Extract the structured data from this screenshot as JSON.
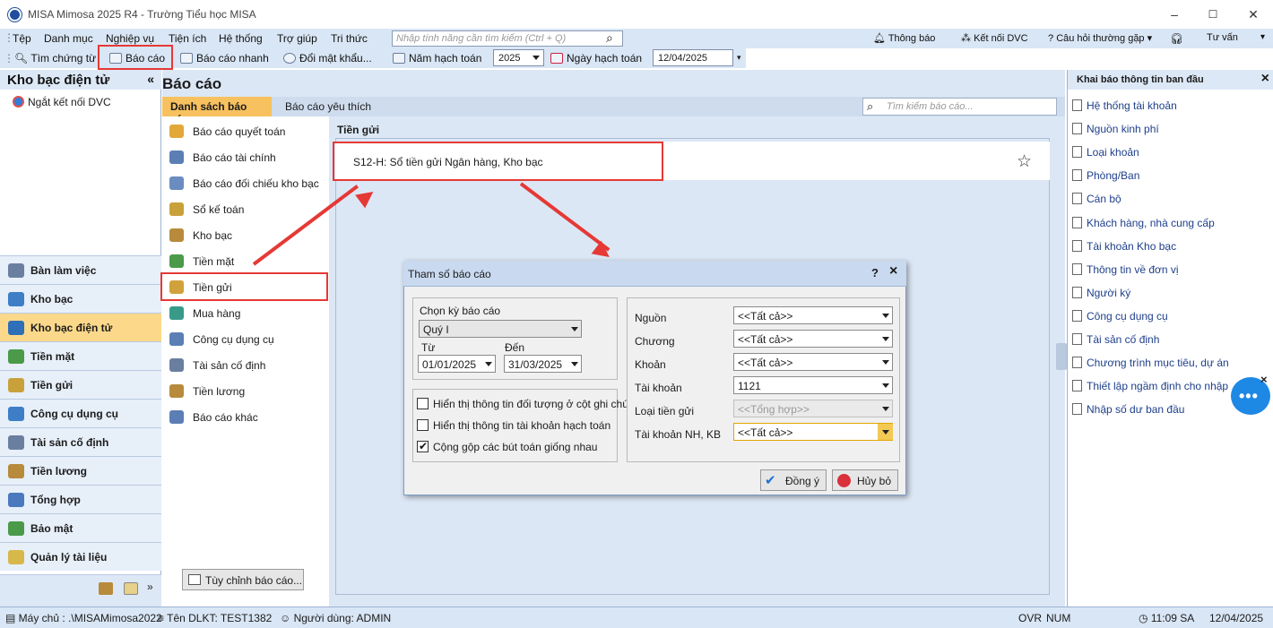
{
  "app": {
    "title": "MISA Mimosa 2025 R4 - Trường Tiểu học MISA"
  },
  "menu": {
    "items": [
      "Tệp",
      "Danh mục",
      "Nghiệp vụ",
      "Tiện ích",
      "Hệ thống",
      "Trợ giúp",
      "Tri thức"
    ],
    "search_placeholder": "Nhập tính năng cần tìm kiếm (Ctrl + Q)",
    "right": {
      "notify": "Thông báo",
      "connect": "Kết nối DVC",
      "faq": "Câu hỏi thường gặp",
      "advisor": "Tư vấn"
    }
  },
  "toolbar": {
    "find": "Tìm chứng từ",
    "report": "Báo cáo",
    "quick": "Báo cáo nhanh",
    "password": "Đổi mật khẩu...",
    "year_label": "Năm hạch toán",
    "year": "2025",
    "date_label": "Ngày hạch toán",
    "date": "12/04/2025"
  },
  "left": {
    "title": "Kho bạc điện tử",
    "collapse": "«",
    "disconnect": "Ngắt kết nối DVC",
    "nav": [
      {
        "label": "Bàn làm việc",
        "active": false
      },
      {
        "label": "Kho bạc",
        "active": false
      },
      {
        "label": "Kho bạc điện tử",
        "active": true
      },
      {
        "label": "Tiền mặt",
        "active": false
      },
      {
        "label": "Tiền gửi",
        "active": false
      },
      {
        "label": "Công cụ dụng cụ",
        "active": false
      },
      {
        "label": "Tài sản cố định",
        "active": false
      },
      {
        "label": "Tiền lương",
        "active": false
      },
      {
        "label": "Tổng hợp",
        "active": false
      },
      {
        "label": "Bảo mật",
        "active": false
      },
      {
        "label": "Quản lý tài liệu",
        "active": false
      }
    ]
  },
  "center": {
    "title": "Báo cáo",
    "tabs": [
      "Danh sách báo cáo",
      "Báo cáo yêu thích"
    ],
    "search_placeholder": "Tìm kiếm báo cáo...",
    "categories": [
      "Báo cáo quyết toán",
      "Báo cáo tài chính",
      "Báo cáo đối chiếu kho bạc",
      "Sổ kế toán",
      "Kho bạc",
      "Tiền mặt",
      "Tiền gửi",
      "Mua hàng",
      "Công cụ dụng cụ",
      "Tài sản cố định",
      "Tiền lương",
      "Báo cáo khác"
    ],
    "customize": "Tùy chỉnh báo cáo...",
    "section": "Tiền gửi",
    "report": "S12-H: Sổ tiền gửi Ngân hàng, Kho bạc"
  },
  "dialog": {
    "title": "Tham số báo cáo",
    "help": "?",
    "close": "×",
    "period_label": "Chọn kỳ báo cáo",
    "period": "Quý I",
    "from_label": "Từ",
    "from": "01/01/2025",
    "to_label": "Đến",
    "to": "31/03/2025",
    "checks": [
      {
        "label": "Hiển thị thông tin đối tượng ở cột ghi chú",
        "checked": false
      },
      {
        "label": "Hiển thị thông tin tài khoản hạch toán",
        "checked": false
      },
      {
        "label": "Cộng gộp các bút toán giống nhau",
        "checked": true
      }
    ],
    "fields": [
      {
        "label": "Nguồn",
        "value": "<<Tất cả>>"
      },
      {
        "label": "Chương",
        "value": "<<Tất cả>>"
      },
      {
        "label": "Khoản",
        "value": "<<Tất cả>>"
      },
      {
        "label": "Tài khoản",
        "value": "1121"
      },
      {
        "label": "Loại tiền gửi",
        "value": "<<Tổng hợp>>"
      },
      {
        "label": "Tài khoản NH, KB",
        "value": "<<Tất cả>>"
      }
    ],
    "ok": "Đồng ý",
    "cancel": "Hủy bỏ"
  },
  "right": {
    "title": "Khai báo thông tin ban đầu",
    "close": "×",
    "items": [
      "Hệ thống tài khoản",
      "Nguồn kinh phí",
      "Loại khoản",
      "Phòng/Ban",
      "Cán bộ",
      "Khách hàng, nhà cung cấp",
      "Tài khoản Kho bạc",
      "Thông tin về đơn vị",
      "Người ký",
      "Công cụ dụng cụ",
      "Tài sản cố định",
      "Chương trình mục tiêu, dự án",
      "Thiết lập ngầm định cho nhập liệu",
      "Nhập số dư ban đầu"
    ]
  },
  "status": {
    "server": "Máy chủ : .\\MISAMimosa2022",
    "db": "Tên DLKT: TEST1382",
    "user": "Người dùng: ADMIN",
    "ovr": "OVR",
    "num": "NUM",
    "time": "11:09 SA",
    "date": "12/04/2025"
  },
  "colors": {
    "accent": "#1f4e9e",
    "highlight": "#e53935",
    "active_nav": "#fcd98a"
  }
}
